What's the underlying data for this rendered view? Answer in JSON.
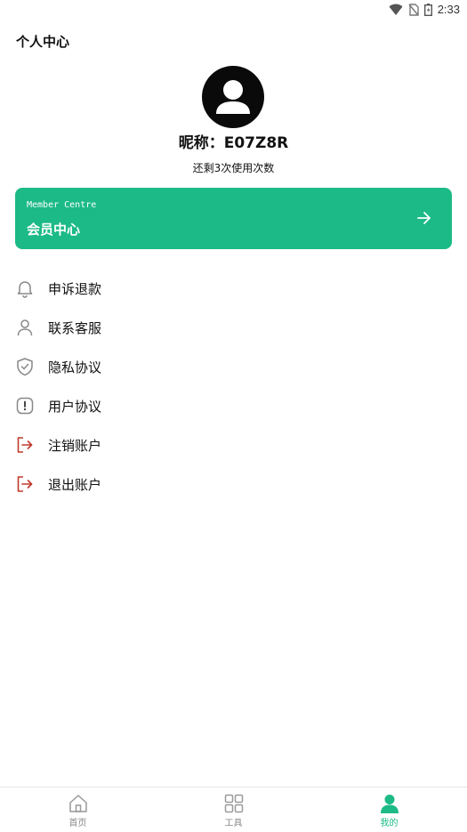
{
  "status_bar": {
    "time": "2:33",
    "icons": [
      "wifi-icon",
      "no-sim-icon",
      "battery-icon"
    ]
  },
  "header": {
    "title": "个人中心"
  },
  "profile": {
    "avatar_icon": "user-avatar-icon",
    "nickname": "昵称：E07Z8R",
    "remaining_text": "还剩3次使用次数"
  },
  "member_card": {
    "subtitle_en": "Member Centre",
    "title": "会员中心",
    "arrow_icon": "arrow-right-icon",
    "color": "#1cba86"
  },
  "menu": {
    "items": [
      {
        "label": "申诉退款",
        "icon": "bell-icon"
      },
      {
        "label": "联系客服",
        "icon": "person-icon"
      },
      {
        "label": "隐私协议",
        "icon": "shield-check-icon"
      },
      {
        "label": "用户协议",
        "icon": "alert-box-icon"
      },
      {
        "label": "注销账户",
        "icon": "logout-icon"
      },
      {
        "label": "退出账户",
        "icon": "logout-icon"
      }
    ]
  },
  "tab_bar": {
    "tabs": [
      {
        "label": "首页",
        "icon": "home-icon",
        "active": false
      },
      {
        "label": "工具",
        "icon": "grid-icon",
        "active": false
      },
      {
        "label": "我的",
        "icon": "user-icon",
        "active": true
      }
    ],
    "active_color": "#1cba86"
  }
}
